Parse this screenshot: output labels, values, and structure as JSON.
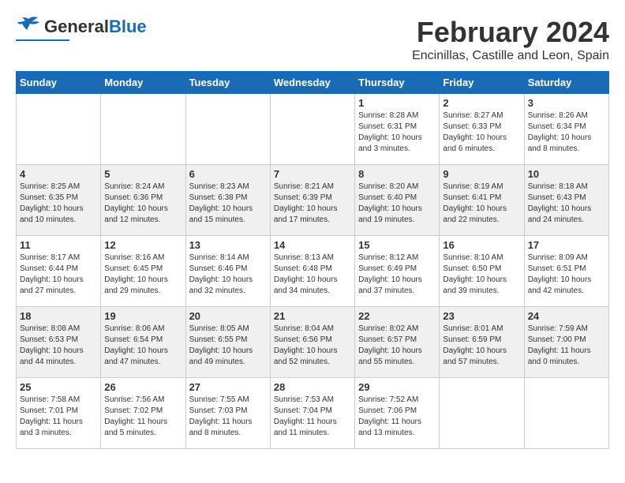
{
  "header": {
    "logo_general": "General",
    "logo_blue": "Blue",
    "month_year": "February 2024",
    "location": "Encinillas, Castille and Leon, Spain"
  },
  "days_of_week": [
    "Sunday",
    "Monday",
    "Tuesday",
    "Wednesday",
    "Thursday",
    "Friday",
    "Saturday"
  ],
  "weeks": [
    [
      {
        "day": "",
        "info": ""
      },
      {
        "day": "",
        "info": ""
      },
      {
        "day": "",
        "info": ""
      },
      {
        "day": "",
        "info": ""
      },
      {
        "day": "1",
        "info": "Sunrise: 8:28 AM\nSunset: 6:31 PM\nDaylight: 10 hours\nand 3 minutes."
      },
      {
        "day": "2",
        "info": "Sunrise: 8:27 AM\nSunset: 6:33 PM\nDaylight: 10 hours\nand 6 minutes."
      },
      {
        "day": "3",
        "info": "Sunrise: 8:26 AM\nSunset: 6:34 PM\nDaylight: 10 hours\nand 8 minutes."
      }
    ],
    [
      {
        "day": "4",
        "info": "Sunrise: 8:25 AM\nSunset: 6:35 PM\nDaylight: 10 hours\nand 10 minutes."
      },
      {
        "day": "5",
        "info": "Sunrise: 8:24 AM\nSunset: 6:36 PM\nDaylight: 10 hours\nand 12 minutes."
      },
      {
        "day": "6",
        "info": "Sunrise: 8:23 AM\nSunset: 6:38 PM\nDaylight: 10 hours\nand 15 minutes."
      },
      {
        "day": "7",
        "info": "Sunrise: 8:21 AM\nSunset: 6:39 PM\nDaylight: 10 hours\nand 17 minutes."
      },
      {
        "day": "8",
        "info": "Sunrise: 8:20 AM\nSunset: 6:40 PM\nDaylight: 10 hours\nand 19 minutes."
      },
      {
        "day": "9",
        "info": "Sunrise: 8:19 AM\nSunset: 6:41 PM\nDaylight: 10 hours\nand 22 minutes."
      },
      {
        "day": "10",
        "info": "Sunrise: 8:18 AM\nSunset: 6:43 PM\nDaylight: 10 hours\nand 24 minutes."
      }
    ],
    [
      {
        "day": "11",
        "info": "Sunrise: 8:17 AM\nSunset: 6:44 PM\nDaylight: 10 hours\nand 27 minutes."
      },
      {
        "day": "12",
        "info": "Sunrise: 8:16 AM\nSunset: 6:45 PM\nDaylight: 10 hours\nand 29 minutes."
      },
      {
        "day": "13",
        "info": "Sunrise: 8:14 AM\nSunset: 6:46 PM\nDaylight: 10 hours\nand 32 minutes."
      },
      {
        "day": "14",
        "info": "Sunrise: 8:13 AM\nSunset: 6:48 PM\nDaylight: 10 hours\nand 34 minutes."
      },
      {
        "day": "15",
        "info": "Sunrise: 8:12 AM\nSunset: 6:49 PM\nDaylight: 10 hours\nand 37 minutes."
      },
      {
        "day": "16",
        "info": "Sunrise: 8:10 AM\nSunset: 6:50 PM\nDaylight: 10 hours\nand 39 minutes."
      },
      {
        "day": "17",
        "info": "Sunrise: 8:09 AM\nSunset: 6:51 PM\nDaylight: 10 hours\nand 42 minutes."
      }
    ],
    [
      {
        "day": "18",
        "info": "Sunrise: 8:08 AM\nSunset: 6:53 PM\nDaylight: 10 hours\nand 44 minutes."
      },
      {
        "day": "19",
        "info": "Sunrise: 8:06 AM\nSunset: 6:54 PM\nDaylight: 10 hours\nand 47 minutes."
      },
      {
        "day": "20",
        "info": "Sunrise: 8:05 AM\nSunset: 6:55 PM\nDaylight: 10 hours\nand 49 minutes."
      },
      {
        "day": "21",
        "info": "Sunrise: 8:04 AM\nSunset: 6:56 PM\nDaylight: 10 hours\nand 52 minutes."
      },
      {
        "day": "22",
        "info": "Sunrise: 8:02 AM\nSunset: 6:57 PM\nDaylight: 10 hours\nand 55 minutes."
      },
      {
        "day": "23",
        "info": "Sunrise: 8:01 AM\nSunset: 6:59 PM\nDaylight: 10 hours\nand 57 minutes."
      },
      {
        "day": "24",
        "info": "Sunrise: 7:59 AM\nSunset: 7:00 PM\nDaylight: 11 hours\nand 0 minutes."
      }
    ],
    [
      {
        "day": "25",
        "info": "Sunrise: 7:58 AM\nSunset: 7:01 PM\nDaylight: 11 hours\nand 3 minutes."
      },
      {
        "day": "26",
        "info": "Sunrise: 7:56 AM\nSunset: 7:02 PM\nDaylight: 11 hours\nand 5 minutes."
      },
      {
        "day": "27",
        "info": "Sunrise: 7:55 AM\nSunset: 7:03 PM\nDaylight: 11 hours\nand 8 minutes."
      },
      {
        "day": "28",
        "info": "Sunrise: 7:53 AM\nSunset: 7:04 PM\nDaylight: 11 hours\nand 11 minutes."
      },
      {
        "day": "29",
        "info": "Sunrise: 7:52 AM\nSunset: 7:06 PM\nDaylight: 11 hours\nand 13 minutes."
      },
      {
        "day": "",
        "info": ""
      },
      {
        "day": "",
        "info": ""
      }
    ]
  ]
}
